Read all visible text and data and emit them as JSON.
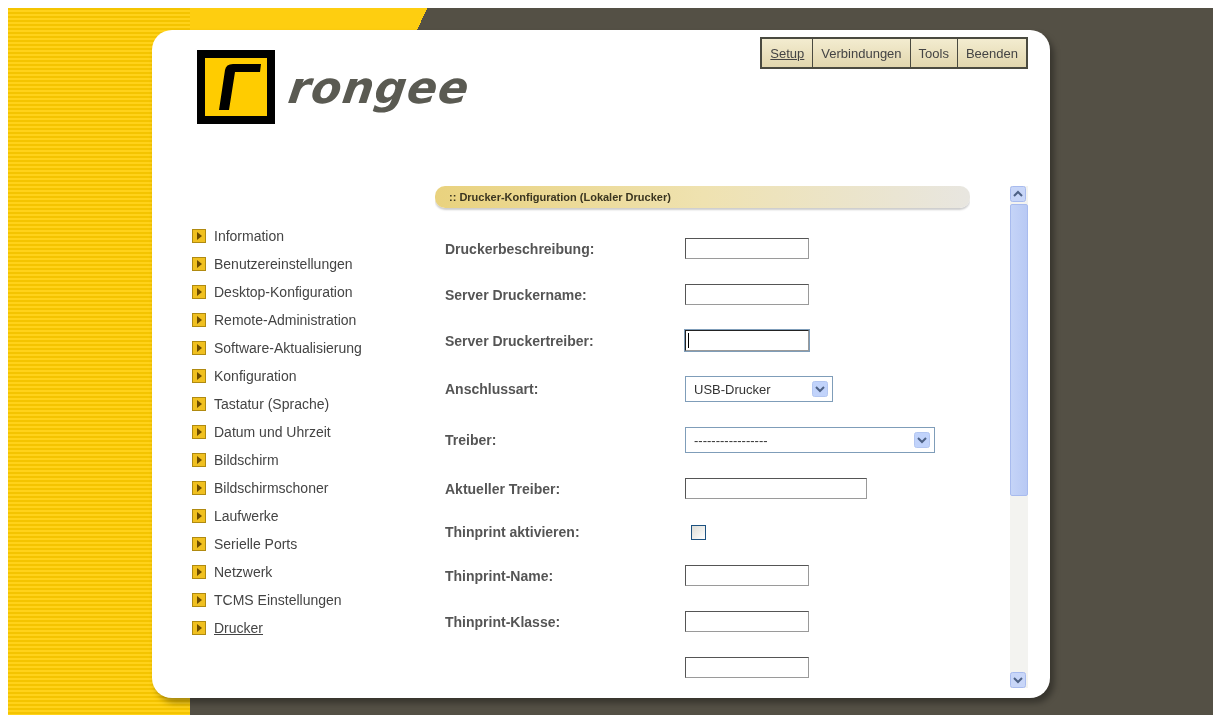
{
  "logo": {
    "text": "rongee"
  },
  "top_menu": [
    {
      "label": "Setup",
      "selected": true
    },
    {
      "label": "Verbindungen",
      "selected": false
    },
    {
      "label": "Tools",
      "selected": false
    },
    {
      "label": "Beenden",
      "selected": false
    }
  ],
  "sidebar": {
    "items": [
      {
        "label": "Information",
        "selected": false
      },
      {
        "label": "Benutzereinstellungen",
        "selected": false
      },
      {
        "label": "Desktop-Konfiguration",
        "selected": false
      },
      {
        "label": "Remote-Administration",
        "selected": false
      },
      {
        "label": "Software-Aktualisierung",
        "selected": false
      },
      {
        "label": "Konfiguration",
        "selected": false
      },
      {
        "label": "Tastatur (Sprache)",
        "selected": false
      },
      {
        "label": "Datum und Uhrzeit",
        "selected": false
      },
      {
        "label": "Bildschirm",
        "selected": false
      },
      {
        "label": "Bildschirmschoner",
        "selected": false
      },
      {
        "label": "Laufwerke",
        "selected": false
      },
      {
        "label": "Serielle Ports",
        "selected": false
      },
      {
        "label": "Netzwerk",
        "selected": false
      },
      {
        "label": "TCMS Einstellungen",
        "selected": false
      },
      {
        "label": "Drucker",
        "selected": true
      }
    ]
  },
  "panel": {
    "title": ":: Drucker-Konfiguration (Lokaler Drucker)",
    "fields": [
      {
        "label": "Druckerbeschreibung:",
        "kind": "text",
        "focused": false
      },
      {
        "label": "Server Druckername:",
        "kind": "text",
        "focused": false
      },
      {
        "label": "Server Druckertreiber:",
        "kind": "text",
        "focused": true
      },
      {
        "label": "Anschlussart:",
        "kind": "select",
        "value": "USB-Drucker"
      },
      {
        "label": "Treiber:",
        "kind": "wide_select",
        "value": "-----------------"
      },
      {
        "label": "Aktueller Treiber:",
        "kind": "long_text",
        "focused": false
      },
      {
        "label": "Thinprint aktivieren:",
        "kind": "checkbox",
        "checked": false
      },
      {
        "label": "Thinprint-Name:",
        "kind": "text",
        "focused": false
      },
      {
        "label": "Thinprint-Klasse:",
        "kind": "text",
        "focused": false
      },
      {
        "kind": "text",
        "focused": false
      }
    ]
  }
}
